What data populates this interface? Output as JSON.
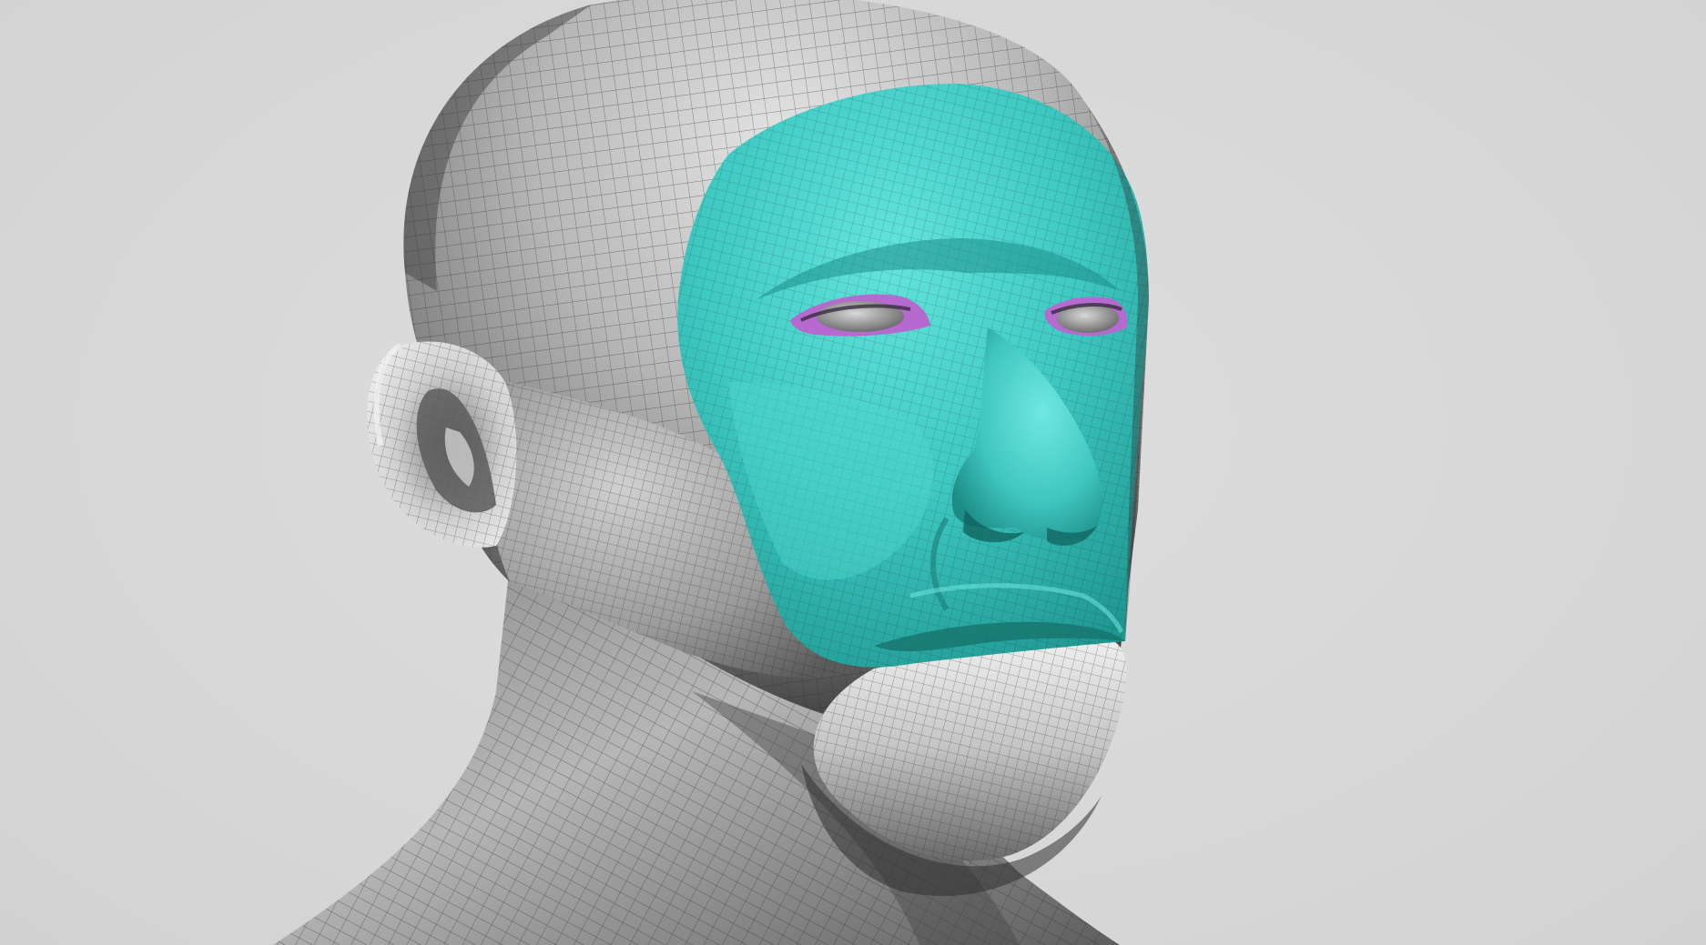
{
  "scene": {
    "subject": "head-mesh",
    "colors": {
      "background": "#d8d8d8",
      "mesh_base": "#a9a9a9",
      "mesh_highlight": "#e8e8e8",
      "mesh_shadow": "#3c3c3c",
      "wire": "#2e2e2e",
      "selection_mask": "#3ec9c2",
      "selection_mask_light": "#5fe0d8",
      "selection_mask_dark": "#229d97",
      "eyelid_mask": "#b66ad0",
      "eyeball": "#9a9a9a"
    }
  }
}
